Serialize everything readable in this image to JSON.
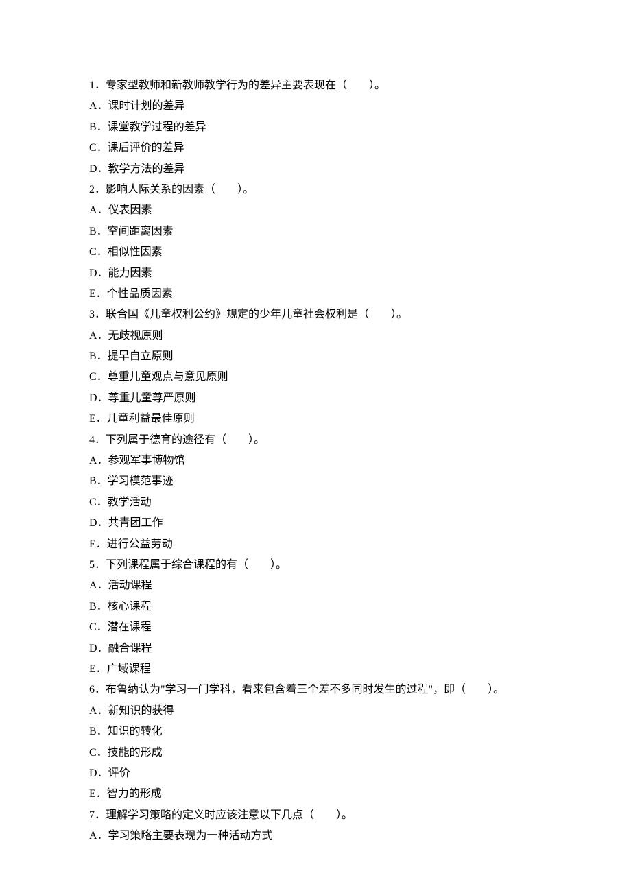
{
  "questions": [
    {
      "num": "1",
      "stem": "专家型教师和新教师教学行为的差异主要表现在（　　）。",
      "options": [
        "A．课时计划的差异",
        "B．课堂教学过程的差异",
        "C．课后评价的差异",
        "D．教学方法的差异"
      ]
    },
    {
      "num": "2",
      "stem": "影响人际关系的因素（　　）。",
      "options": [
        "A．仪表因素",
        "B．空间距离因素",
        "C．相似性因素",
        "D．能力因素",
        "E．个性品质因素"
      ]
    },
    {
      "num": "3",
      "stem": "联合国《儿童权利公约》规定的少年儿童社会权利是（　　）。",
      "options": [
        "A．无歧视原则",
        "B．提早自立原则",
        "C．尊重儿童观点与意见原则",
        "D．尊重儿童尊严原则",
        "E．儿童利益最佳原则"
      ]
    },
    {
      "num": "4",
      "stem": "下列属于德育的途径有（　　）。",
      "options": [
        "A．参观军事博物馆",
        "B．学习模范事迹",
        "C．教学活动",
        "D．共青团工作",
        "E．进行公益劳动"
      ]
    },
    {
      "num": "5",
      "stem": "下列课程属于综合课程的有（　　）。",
      "options": [
        "A．活动课程",
        "B．核心课程",
        "C．潜在课程",
        "D．融合课程",
        "E．广域课程"
      ]
    },
    {
      "num": "6",
      "stem": "布鲁纳认为\"学习一门学科，看来包含着三个差不多同时发生的过程\"，即（　　）。",
      "options": [
        "A．新知识的获得",
        "B．知识的转化",
        "C．技能的形成",
        "D．评价",
        "E．智力的形成"
      ]
    },
    {
      "num": "7",
      "stem": "理解学习策略的定义时应该注意以下几点（　　）。",
      "options": [
        "A．学习策略主要表现为一种活动方式"
      ]
    }
  ]
}
